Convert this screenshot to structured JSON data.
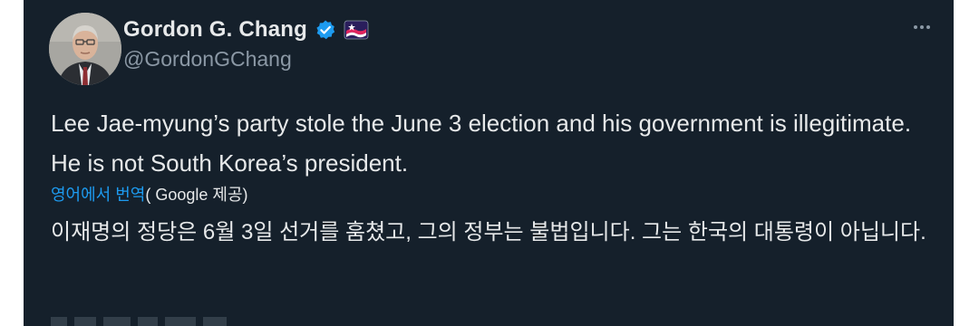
{
  "tweet": {
    "display_name": "Gordon G. Chang",
    "handle": "@GordonGChang",
    "icons": {
      "verified": "verified-badge-icon",
      "affiliate": "affiliate-flag-icon",
      "more": "more-options-icon"
    },
    "text": "Lee Jae-myung’s party stole the June 3 election and his government is illegitimate. He is not South Korea’s president.",
    "translation": {
      "link_label": "영어에서 번역",
      "provider_label": "( Google 제공)",
      "text": "이재명의 정당은 6월 3일 선거를 훔쳤고, 그의 정부는 불법입니다. 그는 한국의 대통령이 아닙니다."
    }
  },
  "colors": {
    "background": "#15202b",
    "text": "#e7e9ea",
    "secondary_text": "#8b98a5",
    "link": "#1d9bf0",
    "verified_badge": "#1d9bf0"
  }
}
